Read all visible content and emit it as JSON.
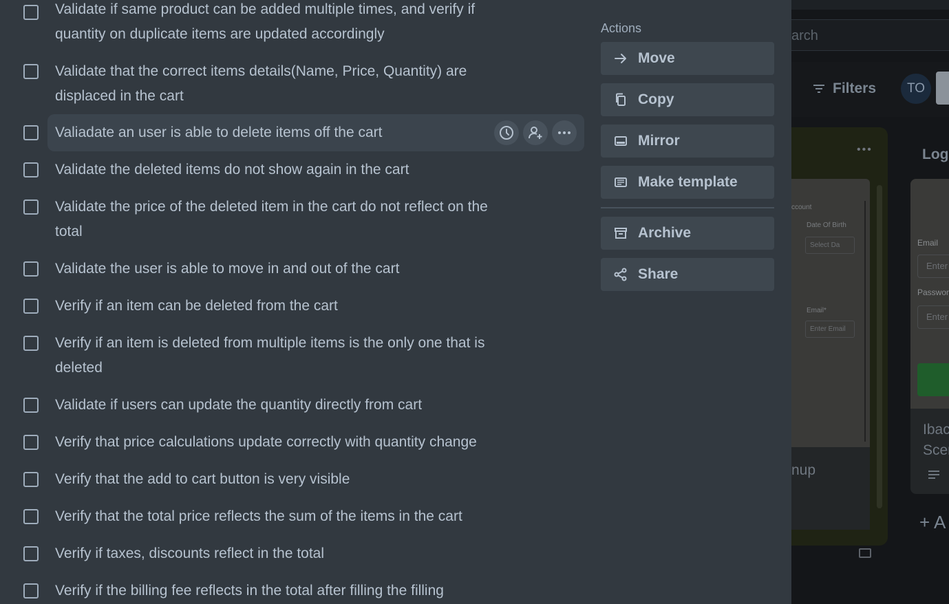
{
  "board": {
    "search_placeholder": "arch",
    "filters_label": "Filters",
    "avatar_initials": "TO",
    "list_menu": "•••",
    "card1": {
      "text_account": "ccount",
      "text_dob": "Date Of Birth",
      "text_dob_placeholder": "Select Da",
      "text_email_label": "Email*",
      "text_email_placeholder": "Enter Email",
      "footer_text": "nup"
    },
    "list2_title": "Log",
    "card2": {
      "email_label": "Email",
      "email_placeholder": "Enter",
      "password_label": "Passworc",
      "password_placeholder": "Enter",
      "title_line1": "Ibac",
      "title_line2": "Scer"
    },
    "add_label": "+ A"
  },
  "checklist": {
    "items": [
      {
        "text": "Validate if same product can be added multiple times, and verify if quantity on duplicate items are updated accordingly"
      },
      {
        "text": "Validate that the correct items details(Name, Price, Quantity) are displaced in the cart"
      },
      {
        "text": "Valiadate an user is able to delete items off the cart"
      },
      {
        "text": "Validate the deleted items do not show again in the cart"
      },
      {
        "text": "Validate the price of the deleted item in the cart do not reflect on the total"
      },
      {
        "text": "Validate the user is able to move in and out of the cart"
      },
      {
        "text": "Verify if an item can be deleted from the cart"
      },
      {
        "text": "Verify if an item is deleted from multiple items is the only one that is deleted"
      },
      {
        "text": "Validate if users can update the quantity directly from cart"
      },
      {
        "text": "Verify that price calculations update correctly with quantity change"
      },
      {
        "text": "Verify that the add to cart button is very visible"
      },
      {
        "text": "Verify that the total price reflects the sum of the items in the cart"
      },
      {
        "text": "Verify if taxes, discounts reflect in the total"
      },
      {
        "text": "Verify if the billing fee reflects in the total after filling the filling"
      }
    ]
  },
  "actions": {
    "label": "Actions",
    "move": "Move",
    "copy": "Copy",
    "mirror": "Mirror",
    "make_template": "Make template",
    "archive": "Archive",
    "share": "Share"
  }
}
